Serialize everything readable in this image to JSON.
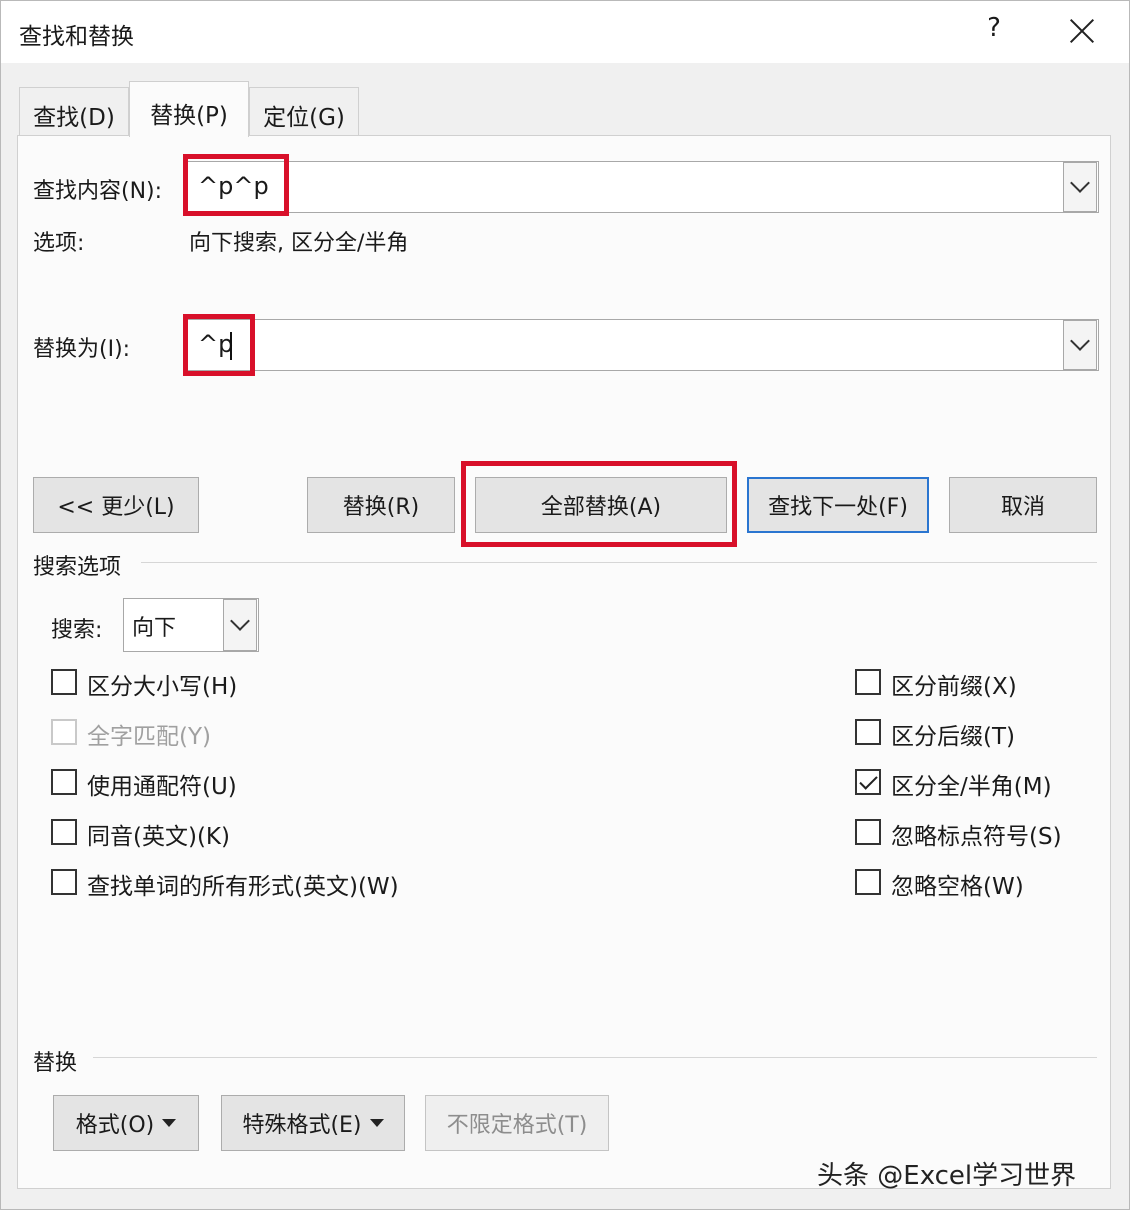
{
  "window": {
    "title": "查找和替换",
    "help": "?"
  },
  "tabs": [
    {
      "label": "查找(D)"
    },
    {
      "label": "替换(P)"
    },
    {
      "label": "定位(G)"
    }
  ],
  "find": {
    "label": "查找内容(N):",
    "value": "^p^p"
  },
  "options": {
    "label": "选项:",
    "value": "向下搜索, 区分全/半角"
  },
  "replace": {
    "label": "替换为(I):",
    "value": "^p"
  },
  "buttons": {
    "less": "<< 更少(L)",
    "replace": "替换(R)",
    "replace_all": "全部替换(A)",
    "find_next": "查找下一处(F)",
    "cancel": "取消"
  },
  "search_options": {
    "title": "搜索选项",
    "search_label": "搜索:",
    "search_value": "向下",
    "left": [
      {
        "label": "区分大小写(H)",
        "checked": false,
        "disabled": false
      },
      {
        "label": "全字匹配(Y)",
        "checked": false,
        "disabled": true
      },
      {
        "label": "使用通配符(U)",
        "checked": false,
        "disabled": false
      },
      {
        "label": "同音(英文)(K)",
        "checked": false,
        "disabled": false
      },
      {
        "label": "查找单词的所有形式(英文)(W)",
        "checked": false,
        "disabled": false
      }
    ],
    "right": [
      {
        "label": "区分前缀(X)",
        "checked": false,
        "disabled": false
      },
      {
        "label": "区分后缀(T)",
        "checked": false,
        "disabled": false
      },
      {
        "label": "区分全/半角(M)",
        "checked": true,
        "disabled": false
      },
      {
        "label": "忽略标点符号(S)",
        "checked": false,
        "disabled": false
      },
      {
        "label": "忽略空格(W)",
        "checked": false,
        "disabled": false
      }
    ]
  },
  "replace_section": {
    "title": "替换",
    "format": "格式(O)",
    "special": "特殊格式(E)",
    "no_format": "不限定格式(T)"
  },
  "watermark": "头条 @Excel学习世界",
  "colors": {
    "highlight": "#d8102a",
    "focus": "#2a75d0"
  }
}
